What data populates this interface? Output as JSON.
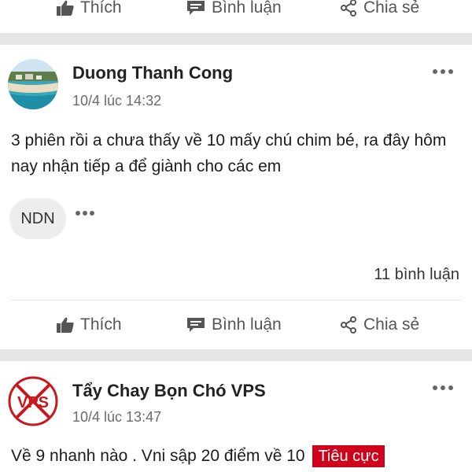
{
  "top_actions": {
    "like": "Thích",
    "comment": "Bình luận",
    "share": "Chia sẻ"
  },
  "post1": {
    "author": "Duong Thanh Cong",
    "time": "10/4 lúc 14:32",
    "text": "3 phiên rồi a chưa thấy về 10 mấy chú chim bé, ra đây hôm nay nhận tiếp a để giành cho các em",
    "tag": "NDN",
    "comments": "11 bình luận",
    "actions": {
      "like": "Thích",
      "comment": "Bình luận",
      "share": "Chia sẻ"
    }
  },
  "post2": {
    "author": "Tẩy Chay Bọn Chó VPS",
    "time": "10/4 lúc 13:47",
    "text": "Về 9 nhanh nào . Vni sập 20 điểm về 10",
    "badge": "Tiêu cực",
    "badge_color": "#d0021b"
  },
  "icons": {
    "like": "thumbs-up-icon",
    "comment": "comment-icon",
    "share": "share-icon",
    "more": "more-dots-icon"
  }
}
